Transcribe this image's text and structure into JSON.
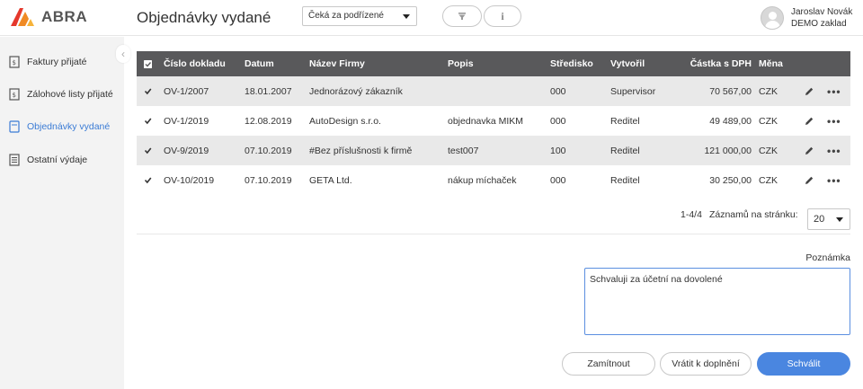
{
  "app": {
    "logo_text": "ABRA"
  },
  "header": {
    "title": "Objednávky vydané",
    "status_filter": "Čeká za podřízené",
    "info_label": "i",
    "user_name": "Jaroslav Novák",
    "company": "DEMO zaklad"
  },
  "sidebar": {
    "items": [
      {
        "label": "Faktury přijaté",
        "icon": "invoice-icon"
      },
      {
        "label": "Zálohové listy přijaté",
        "icon": "advance-invoice-icon"
      },
      {
        "label": "Objednávky vydané",
        "icon": "order-icon",
        "active": true
      },
      {
        "label": "Ostatní výdaje",
        "icon": "expense-icon"
      }
    ]
  },
  "table": {
    "columns": [
      "Číslo dokladu",
      "Datum",
      "Název Firmy",
      "Popis",
      "Středisko",
      "Vytvořil",
      "Částka s DPH",
      "Měna"
    ],
    "rows": [
      {
        "number": "OV-1/2007",
        "date": "18.01.2007",
        "company": "Jednorázový zákazník",
        "description": "",
        "center": "000",
        "created_by": "Supervisor",
        "amount": "70 567,00",
        "currency": "CZK",
        "checked": true
      },
      {
        "number": "OV-1/2019",
        "date": "12.08.2019",
        "company": "AutoDesign s.r.o.",
        "description": "objednavka MIKM",
        "center": "000",
        "created_by": "Reditel",
        "amount": "49 489,00",
        "currency": "CZK",
        "checked": true
      },
      {
        "number": "OV-9/2019",
        "date": "07.10.2019",
        "company": "#Bez příslušnosti k firmě",
        "description": "test007",
        "center": "100",
        "created_by": "Reditel",
        "amount": "121 000,00",
        "currency": "CZK",
        "checked": true
      },
      {
        "number": "OV-10/2019",
        "date": "07.10.2019",
        "company": "GETA Ltd.",
        "description": "nákup míchaček",
        "center": "000",
        "created_by": "Reditel",
        "amount": "30 250,00",
        "currency": "CZK",
        "checked": true
      }
    ],
    "more_label": "•••"
  },
  "pager": {
    "range": "1-4/4",
    "per_page_label": "Záznamů na stránku:",
    "per_page": "20"
  },
  "note": {
    "label": "Poznámka",
    "value": "Schvaluji za účetní na dovolené"
  },
  "actions": {
    "reject": "Zamítnout",
    "return": "Vrátit k doplnění",
    "approve": "Schválit"
  },
  "colors": {
    "accent": "#4a86e0",
    "header_row": "#59595b",
    "active_nav": "#3a7bd5"
  }
}
